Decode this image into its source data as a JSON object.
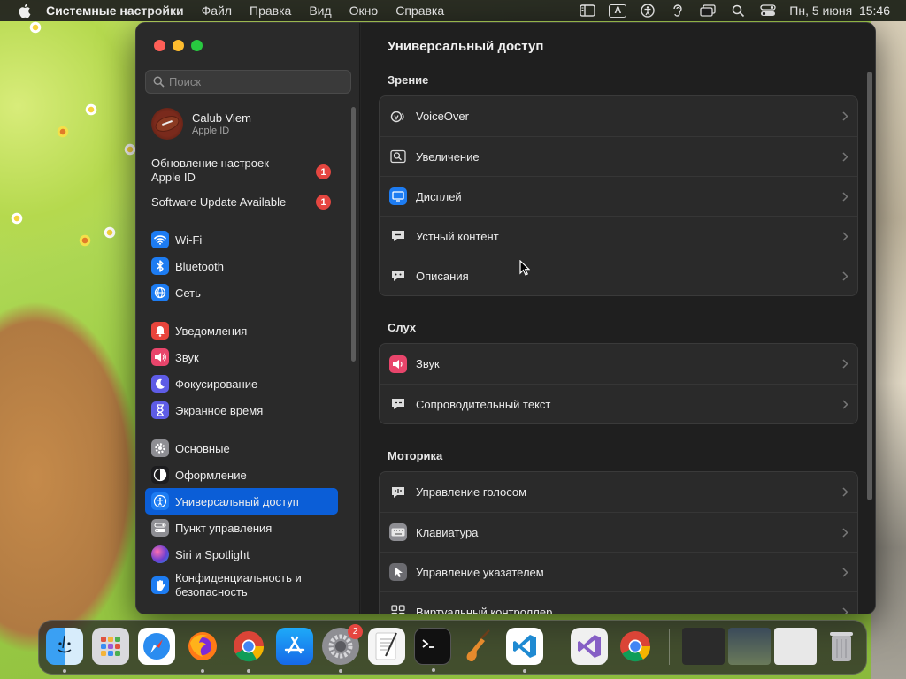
{
  "menubar": {
    "app_name": "Системные настройки",
    "items": [
      "Файл",
      "Правка",
      "Вид",
      "Окно",
      "Справка"
    ],
    "status_icons": [
      "sidebar-icon",
      "input-source-icon",
      "accessibility-icon",
      "hearing-icon",
      "window-icon",
      "search-icon",
      "control-center-icon"
    ],
    "input_source_label": "A",
    "clock": "Пн, 5 июня  15:46"
  },
  "sidebar": {
    "search_placeholder": "Поиск",
    "account": {
      "name": "Calub Viem",
      "subtitle": "Apple ID"
    },
    "alerts": [
      {
        "label": "Обновление настроек Apple ID",
        "badge": "1"
      },
      {
        "label": "Software Update Available",
        "badge": "1"
      }
    ],
    "groups": [
      [
        {
          "label": "Wi-Fi",
          "icon": "wifi-icon",
          "color": "#1d7cf2"
        },
        {
          "label": "Bluetooth",
          "icon": "bluetooth-icon",
          "color": "#1d7cf2"
        },
        {
          "label": "Сеть",
          "icon": "globe-icon",
          "color": "#1d7cf2"
        }
      ],
      [
        {
          "label": "Уведомления",
          "icon": "bell-icon",
          "color": "#e8453c"
        },
        {
          "label": "Звук",
          "icon": "speaker-icon",
          "color": "#e8456b"
        },
        {
          "label": "Фокусирование",
          "icon": "moon-icon",
          "color": "#5e5ce6"
        },
        {
          "label": "Экранное время",
          "icon": "hourglass-icon",
          "color": "#5e5ce6"
        }
      ],
      [
        {
          "label": "Основные",
          "icon": "gear-icon",
          "color": "#8e8e93"
        },
        {
          "label": "Оформление",
          "icon": "appearance-icon",
          "color": "#1c1c1e"
        },
        {
          "label": "Универсальный доступ",
          "icon": "accessibility-icon",
          "color": "#1d7cf2",
          "active": true
        },
        {
          "label": "Пункт управления",
          "icon": "control-center-icon",
          "color": "#8e8e93"
        },
        {
          "label": "Siri и Spotlight",
          "icon": "siri-icon",
          "color": "#6b3fd1"
        },
        {
          "label": "Конфиденциальность и безопасность",
          "icon": "hand-icon",
          "color": "#1d7cf2"
        }
      ]
    ]
  },
  "content": {
    "title": "Универсальный доступ",
    "sections": [
      {
        "title": "Зрение",
        "rows": [
          {
            "label": "VoiceOver",
            "icon": "voiceover-icon"
          },
          {
            "label": "Увеличение",
            "icon": "zoom-icon"
          },
          {
            "label": "Дисплей",
            "icon": "display-icon"
          },
          {
            "label": "Устный контент",
            "icon": "spoken-content-icon"
          },
          {
            "label": "Описания",
            "icon": "descriptions-icon"
          }
        ]
      },
      {
        "title": "Слух",
        "rows": [
          {
            "label": "Звук",
            "icon": "speaker-icon"
          },
          {
            "label": "Сопроводительный текст",
            "icon": "captions-icon"
          }
        ]
      },
      {
        "title": "Моторика",
        "rows": [
          {
            "label": "Управление голосом",
            "icon": "voice-control-icon"
          },
          {
            "label": "Клавиатура",
            "icon": "keyboard-icon"
          },
          {
            "label": "Управление указателем",
            "icon": "pointer-icon"
          },
          {
            "label": "Виртуальный контроллер",
            "icon": "switch-control-icon"
          }
        ]
      }
    ]
  },
  "dock": {
    "apps": [
      "finder-icon",
      "launchpad-icon",
      "safari-icon",
      "firefox-icon",
      "chrome-icon",
      "app-store-icon",
      "system-settings-icon",
      "textedit-icon",
      "terminal-icon",
      "garageband-icon",
      "vscode-icon",
      "visual-studio-icon",
      "chrome-icon",
      "desktop-thumbnail-icon",
      "desktop-thumbnail-icon",
      "desktop-thumbnail-icon",
      "trash-icon"
    ],
    "settings_badge": "2"
  }
}
